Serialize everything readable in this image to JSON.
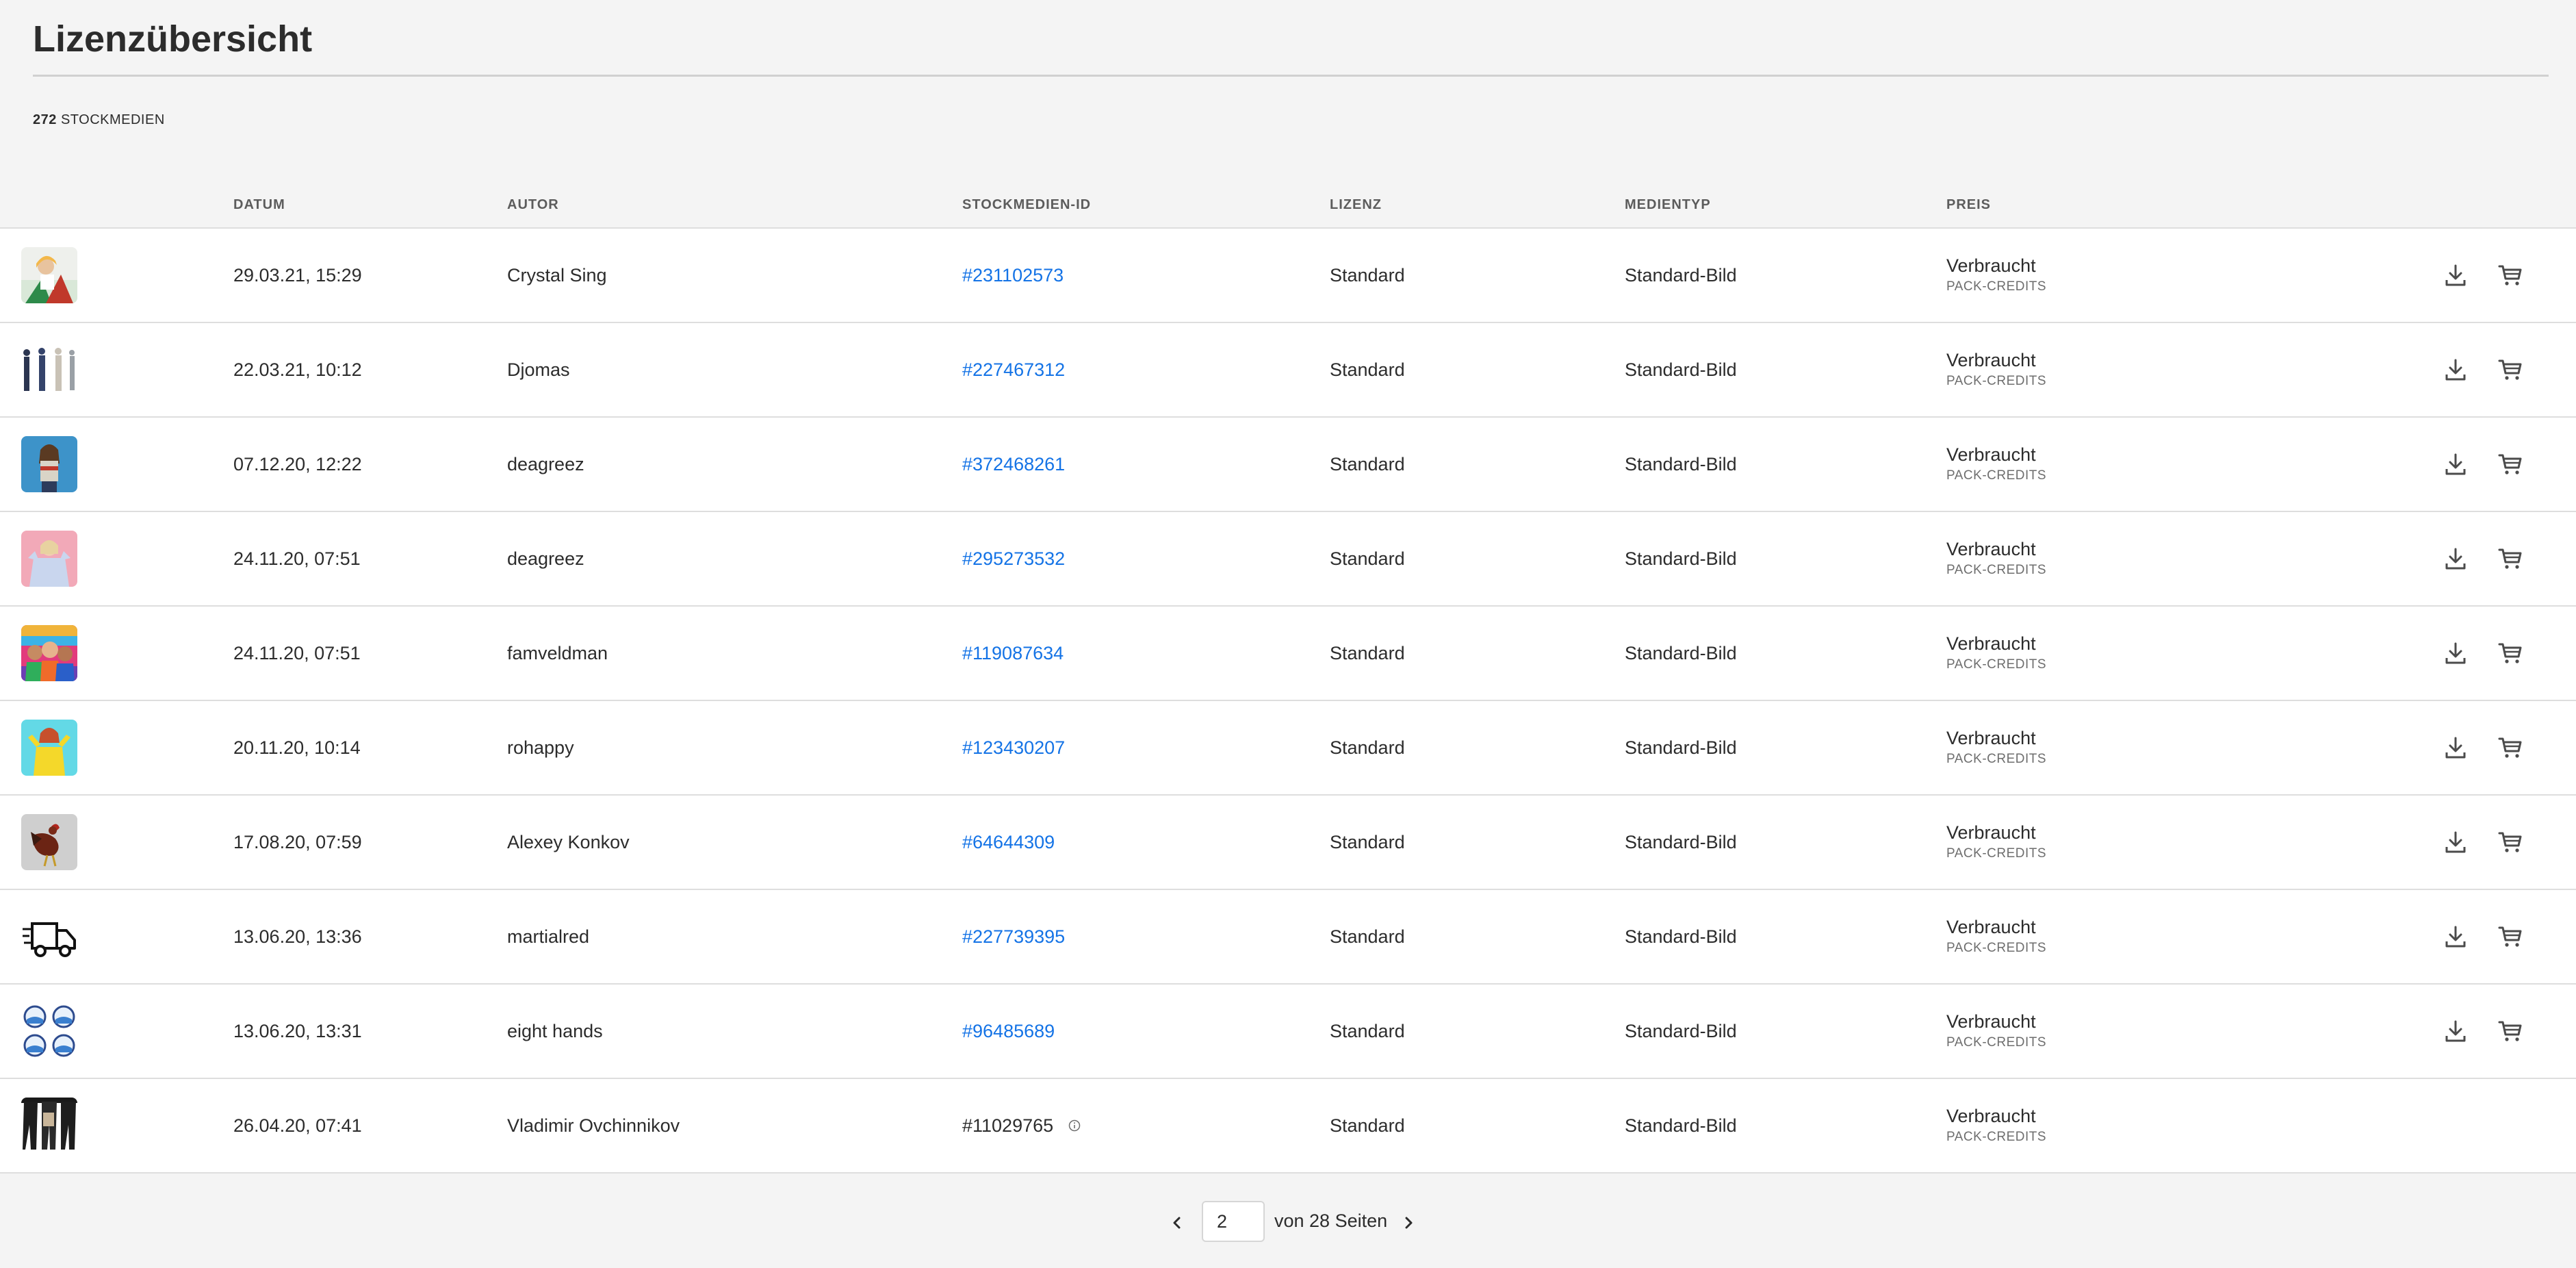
{
  "page": {
    "title": "Lizenzübersicht",
    "count_number": "272",
    "count_label": "STOCKMEDIEN"
  },
  "table": {
    "headers": {
      "date": "DATUM",
      "author": "AUTOR",
      "id": "STOCKMEDIEN-ID",
      "license": "LIZENZ",
      "media_type": "MEDIENTYP",
      "price": "PREIS"
    },
    "rows": [
      {
        "date": "29.03.21, 15:29",
        "author": "Crystal Sing",
        "id": "#231102573",
        "license": "Standard",
        "media_type": "Standard-Bild",
        "price": "Verbraucht",
        "price_note": "PACK-CREDITS"
      },
      {
        "date": "22.03.21, 10:12",
        "author": "Djomas",
        "id": "#227467312",
        "license": "Standard",
        "media_type": "Standard-Bild",
        "price": "Verbraucht",
        "price_note": "PACK-CREDITS"
      },
      {
        "date": "07.12.20, 12:22",
        "author": "deagreez",
        "id": "#372468261",
        "license": "Standard",
        "media_type": "Standard-Bild",
        "price": "Verbraucht",
        "price_note": "PACK-CREDITS"
      },
      {
        "date": "24.11.20, 07:51",
        "author": "deagreez",
        "id": "#295273532",
        "license": "Standard",
        "media_type": "Standard-Bild",
        "price": "Verbraucht",
        "price_note": "PACK-CREDITS"
      },
      {
        "date": "24.11.20, 07:51",
        "author": "famveldman",
        "id": "#119087634",
        "license": "Standard",
        "media_type": "Standard-Bild",
        "price": "Verbraucht",
        "price_note": "PACK-CREDITS"
      },
      {
        "date": "20.11.20, 10:14",
        "author": "rohappy",
        "id": "#123430207",
        "license": "Standard",
        "media_type": "Standard-Bild",
        "price": "Verbraucht",
        "price_note": "PACK-CREDITS"
      },
      {
        "date": "17.08.20, 07:59",
        "author": "Alexey Konkov",
        "id": "#64644309",
        "license": "Standard",
        "media_type": "Standard-Bild",
        "price": "Verbraucht",
        "price_note": "PACK-CREDITS"
      },
      {
        "date": "13.06.20, 13:36",
        "author": "martialred",
        "id": "#227739395",
        "license": "Standard",
        "media_type": "Standard-Bild",
        "price": "Verbraucht",
        "price_note": "PACK-CREDITS"
      },
      {
        "date": "13.06.20, 13:31",
        "author": "eight hands",
        "id": "#96485689",
        "license": "Standard",
        "media_type": "Standard-Bild",
        "price": "Verbraucht",
        "price_note": "PACK-CREDITS"
      },
      {
        "date": "26.04.20, 07:41",
        "author": "Vladimir Ovchinnikov",
        "id": "#11029765",
        "license": "Standard",
        "media_type": "Standard-Bild",
        "price": "Verbraucht",
        "price_note": "PACK-CREDITS"
      }
    ]
  },
  "pagination": {
    "current_page": "2",
    "total_label": "von 28 Seiten"
  },
  "colors": {
    "link": "#1473e6",
    "row_background": "#ffffff",
    "page_background": "#f4f4f4"
  }
}
